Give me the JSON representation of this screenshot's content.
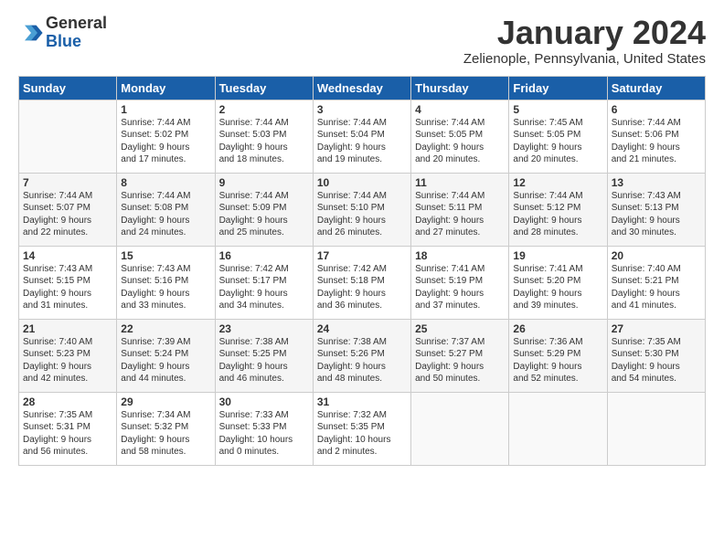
{
  "header": {
    "logo_line1": "General",
    "logo_line2": "Blue",
    "title": "January 2024",
    "subtitle": "Zelienople, Pennsylvania, United States"
  },
  "days_header": [
    "Sunday",
    "Monday",
    "Tuesday",
    "Wednesday",
    "Thursday",
    "Friday",
    "Saturday"
  ],
  "weeks": [
    [
      {
        "num": "",
        "content": ""
      },
      {
        "num": "1",
        "content": "Sunrise: 7:44 AM\nSunset: 5:02 PM\nDaylight: 9 hours\nand 17 minutes."
      },
      {
        "num": "2",
        "content": "Sunrise: 7:44 AM\nSunset: 5:03 PM\nDaylight: 9 hours\nand 18 minutes."
      },
      {
        "num": "3",
        "content": "Sunrise: 7:44 AM\nSunset: 5:04 PM\nDaylight: 9 hours\nand 19 minutes."
      },
      {
        "num": "4",
        "content": "Sunrise: 7:44 AM\nSunset: 5:05 PM\nDaylight: 9 hours\nand 20 minutes."
      },
      {
        "num": "5",
        "content": "Sunrise: 7:45 AM\nSunset: 5:05 PM\nDaylight: 9 hours\nand 20 minutes."
      },
      {
        "num": "6",
        "content": "Sunrise: 7:44 AM\nSunset: 5:06 PM\nDaylight: 9 hours\nand 21 minutes."
      }
    ],
    [
      {
        "num": "7",
        "content": "Sunrise: 7:44 AM\nSunset: 5:07 PM\nDaylight: 9 hours\nand 22 minutes."
      },
      {
        "num": "8",
        "content": "Sunrise: 7:44 AM\nSunset: 5:08 PM\nDaylight: 9 hours\nand 24 minutes."
      },
      {
        "num": "9",
        "content": "Sunrise: 7:44 AM\nSunset: 5:09 PM\nDaylight: 9 hours\nand 25 minutes."
      },
      {
        "num": "10",
        "content": "Sunrise: 7:44 AM\nSunset: 5:10 PM\nDaylight: 9 hours\nand 26 minutes."
      },
      {
        "num": "11",
        "content": "Sunrise: 7:44 AM\nSunset: 5:11 PM\nDaylight: 9 hours\nand 27 minutes."
      },
      {
        "num": "12",
        "content": "Sunrise: 7:44 AM\nSunset: 5:12 PM\nDaylight: 9 hours\nand 28 minutes."
      },
      {
        "num": "13",
        "content": "Sunrise: 7:43 AM\nSunset: 5:13 PM\nDaylight: 9 hours\nand 30 minutes."
      }
    ],
    [
      {
        "num": "14",
        "content": "Sunrise: 7:43 AM\nSunset: 5:15 PM\nDaylight: 9 hours\nand 31 minutes."
      },
      {
        "num": "15",
        "content": "Sunrise: 7:43 AM\nSunset: 5:16 PM\nDaylight: 9 hours\nand 33 minutes."
      },
      {
        "num": "16",
        "content": "Sunrise: 7:42 AM\nSunset: 5:17 PM\nDaylight: 9 hours\nand 34 minutes."
      },
      {
        "num": "17",
        "content": "Sunrise: 7:42 AM\nSunset: 5:18 PM\nDaylight: 9 hours\nand 36 minutes."
      },
      {
        "num": "18",
        "content": "Sunrise: 7:41 AM\nSunset: 5:19 PM\nDaylight: 9 hours\nand 37 minutes."
      },
      {
        "num": "19",
        "content": "Sunrise: 7:41 AM\nSunset: 5:20 PM\nDaylight: 9 hours\nand 39 minutes."
      },
      {
        "num": "20",
        "content": "Sunrise: 7:40 AM\nSunset: 5:21 PM\nDaylight: 9 hours\nand 41 minutes."
      }
    ],
    [
      {
        "num": "21",
        "content": "Sunrise: 7:40 AM\nSunset: 5:23 PM\nDaylight: 9 hours\nand 42 minutes."
      },
      {
        "num": "22",
        "content": "Sunrise: 7:39 AM\nSunset: 5:24 PM\nDaylight: 9 hours\nand 44 minutes."
      },
      {
        "num": "23",
        "content": "Sunrise: 7:38 AM\nSunset: 5:25 PM\nDaylight: 9 hours\nand 46 minutes."
      },
      {
        "num": "24",
        "content": "Sunrise: 7:38 AM\nSunset: 5:26 PM\nDaylight: 9 hours\nand 48 minutes."
      },
      {
        "num": "25",
        "content": "Sunrise: 7:37 AM\nSunset: 5:27 PM\nDaylight: 9 hours\nand 50 minutes."
      },
      {
        "num": "26",
        "content": "Sunrise: 7:36 AM\nSunset: 5:29 PM\nDaylight: 9 hours\nand 52 minutes."
      },
      {
        "num": "27",
        "content": "Sunrise: 7:35 AM\nSunset: 5:30 PM\nDaylight: 9 hours\nand 54 minutes."
      }
    ],
    [
      {
        "num": "28",
        "content": "Sunrise: 7:35 AM\nSunset: 5:31 PM\nDaylight: 9 hours\nand 56 minutes."
      },
      {
        "num": "29",
        "content": "Sunrise: 7:34 AM\nSunset: 5:32 PM\nDaylight: 9 hours\nand 58 minutes."
      },
      {
        "num": "30",
        "content": "Sunrise: 7:33 AM\nSunset: 5:33 PM\nDaylight: 10 hours\nand 0 minutes."
      },
      {
        "num": "31",
        "content": "Sunrise: 7:32 AM\nSunset: 5:35 PM\nDaylight: 10 hours\nand 2 minutes."
      },
      {
        "num": "",
        "content": ""
      },
      {
        "num": "",
        "content": ""
      },
      {
        "num": "",
        "content": ""
      }
    ]
  ]
}
